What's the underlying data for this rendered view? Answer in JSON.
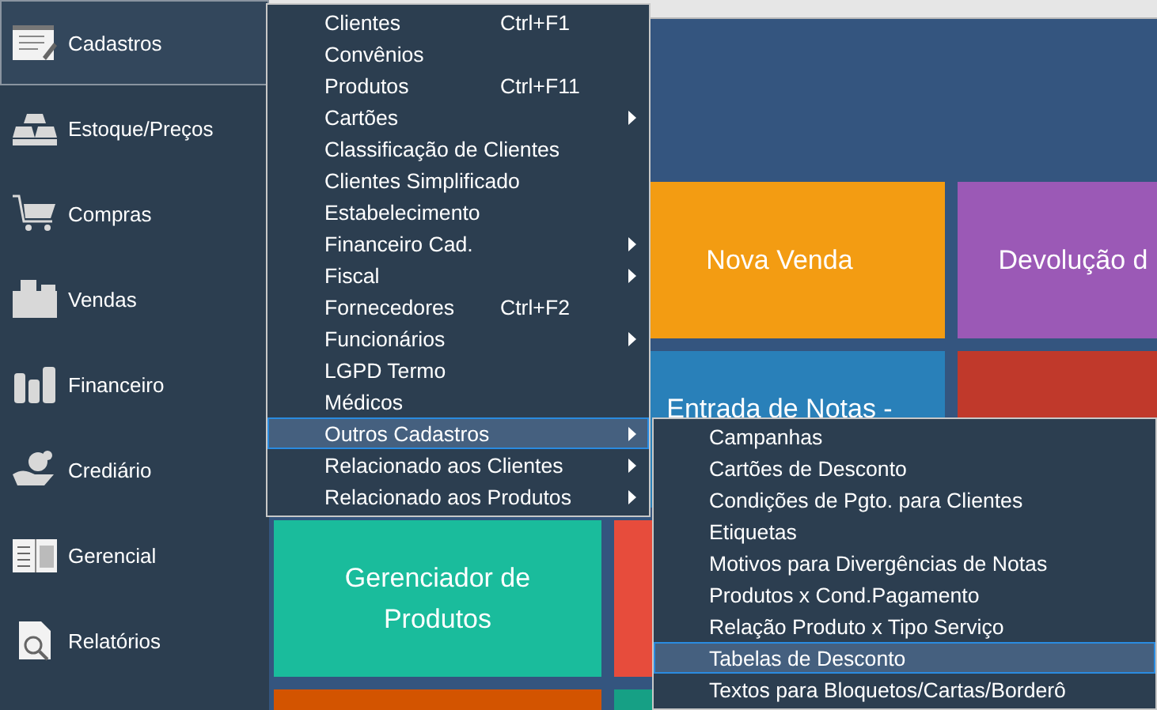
{
  "sidebar": {
    "items": [
      {
        "label": "Cadastros",
        "selected": true
      },
      {
        "label": "Estoque/Preços",
        "selected": false
      },
      {
        "label": "Compras",
        "selected": false
      },
      {
        "label": "Vendas",
        "selected": false
      },
      {
        "label": "Financeiro",
        "selected": false
      },
      {
        "label": "Crediário",
        "selected": false
      },
      {
        "label": "Gerencial",
        "selected": false
      },
      {
        "label": "Relatórios",
        "selected": false
      }
    ]
  },
  "tile_rows": [
    {
      "tiles": [
        {
          "label": "Nova Venda",
          "color": "#f39c12"
        },
        {
          "label": "Devolução d",
          "color": "#9b59b6"
        }
      ]
    },
    {
      "tiles": [
        {
          "label": "Entrada de Notas -",
          "color": "#2980b9"
        },
        {
          "color": "#c0392b"
        }
      ]
    },
    {
      "tiles": [
        {
          "label": "Gerenciador de Produtos",
          "color": "#1abc9c"
        },
        {
          "color": "#e74c3c"
        }
      ]
    },
    {
      "tiles": [
        {
          "color": "#d35400"
        },
        {
          "color": "#16a085"
        }
      ]
    }
  ],
  "menu": {
    "items": [
      {
        "label": "Clientes",
        "shortcut": "Ctrl+F1",
        "submenu": false,
        "selected": false
      },
      {
        "label": "Convênios",
        "submenu": false,
        "selected": false
      },
      {
        "label": "Produtos",
        "shortcut": "Ctrl+F11",
        "submenu": false,
        "selected": false
      },
      {
        "label": "Cartões",
        "submenu": true,
        "selected": false
      },
      {
        "label": "Classificação de Clientes",
        "submenu": false,
        "selected": false
      },
      {
        "label": "Clientes Simplificado",
        "submenu": false,
        "selected": false
      },
      {
        "label": "Estabelecimento",
        "submenu": false,
        "selected": false
      },
      {
        "label": "Financeiro Cad.",
        "submenu": true,
        "selected": false
      },
      {
        "label": "Fiscal",
        "submenu": true,
        "selected": false
      },
      {
        "label": "Fornecedores",
        "shortcut": "Ctrl+F2",
        "submenu": false,
        "selected": false
      },
      {
        "label": "Funcionários",
        "submenu": true,
        "selected": false
      },
      {
        "label": "LGPD Termo",
        "submenu": false,
        "selected": false
      },
      {
        "label": "Médicos",
        "submenu": false,
        "selected": false
      },
      {
        "label": "Outros Cadastros",
        "submenu": true,
        "selected": true
      },
      {
        "label": "Relacionado aos Clientes",
        "submenu": true,
        "selected": false
      },
      {
        "label": "Relacionado aos Produtos",
        "submenu": true,
        "selected": false
      }
    ]
  },
  "submenu": {
    "items": [
      {
        "label": "Campanhas",
        "selected": false
      },
      {
        "label": "Cartões de Desconto",
        "selected": false
      },
      {
        "label": "Condições de Pgto. para Clientes",
        "selected": false
      },
      {
        "label": "Etiquetas",
        "selected": false
      },
      {
        "label": "Motivos para Divergências de Notas",
        "selected": false
      },
      {
        "label": "Produtos x Cond.Pagamento",
        "selected": false
      },
      {
        "label": "Relação Produto x Tipo Serviço",
        "selected": false
      },
      {
        "label": "Tabelas de Desconto",
        "selected": true
      },
      {
        "label": "Textos para Bloquetos/Cartas/Borderô",
        "selected": false
      }
    ]
  }
}
